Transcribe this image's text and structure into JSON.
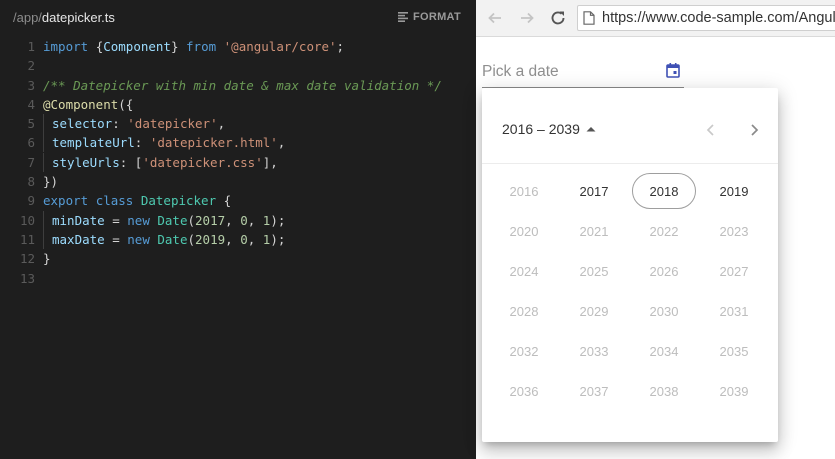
{
  "editor": {
    "path_dir": "/app/",
    "path_file": "datepicker.ts",
    "format_label": "FORMAT",
    "lines": [
      "1",
      "2",
      "3",
      "4",
      "5",
      "6",
      "7",
      "8",
      "9",
      "10",
      "11",
      "12",
      "13"
    ],
    "code": {
      "l1_import": "import ",
      "l1_brace_open": "{",
      "l1_component": "Component",
      "l1_brace_close": "} ",
      "l1_from": "from ",
      "l1_module": "'@angular/core'",
      "l1_semi": ";",
      "l3_comment": "/** Datepicker with min date & max date validation */",
      "l4_decorator": "@Component",
      "l4_paren": "({",
      "l5_key": "selector",
      "l5_colon": ": ",
      "l5_val": "'datepicker'",
      "l5_comma": ",",
      "l6_key": "templateUrl",
      "l6_colon": ": ",
      "l6_val": "'datepicker.html'",
      "l6_comma": ",",
      "l7_key": "styleUrls",
      "l7_colon": ": [",
      "l7_val": "'datepicker.css'",
      "l7_end": "],",
      "l8_close": "})",
      "l9_export": "export ",
      "l9_class": "class ",
      "l9_name": "Datepicker",
      "l9_brace": " {",
      "l10_prop": "minDate",
      "l10_eq": " = ",
      "l10_new": "new ",
      "l10_type": "Date",
      "l10_args_open": "(",
      "l10_n1": "2017",
      "l10_sep1": ", ",
      "l10_n2": "0",
      "l10_sep2": ", ",
      "l10_n3": "1",
      "l10_end": ");",
      "l11_prop": "maxDate",
      "l11_eq": " = ",
      "l11_new": "new ",
      "l11_type": "Date",
      "l11_args_open": "(",
      "l11_n1": "2019",
      "l11_sep1": ", ",
      "l11_n2": "0",
      "l11_sep2": ", ",
      "l11_n3": "1",
      "l11_end": ");",
      "l12_close": "}"
    }
  },
  "browser": {
    "url": "https://www.code-sample.com/Angular",
    "back_icon": "arrow-left-icon",
    "forward_icon": "arrow-right-icon",
    "reload_icon": "reload-icon",
    "page_icon": "page-icon"
  },
  "datepicker": {
    "placeholder": "Pick a date",
    "toggle_icon": "calendar-icon",
    "period_label": "2016 – 2039",
    "period_icon": "caret-up-icon",
    "prev_icon": "chevron-left-icon",
    "next_icon": "chevron-right-icon",
    "accent_color": "#3f51b5",
    "today_year": "2018",
    "years": [
      {
        "label": "2016",
        "enabled": false
      },
      {
        "label": "2017",
        "enabled": true
      },
      {
        "label": "2018",
        "enabled": true
      },
      {
        "label": "2019",
        "enabled": true
      },
      {
        "label": "2020",
        "enabled": false
      },
      {
        "label": "2021",
        "enabled": false
      },
      {
        "label": "2022",
        "enabled": false
      },
      {
        "label": "2023",
        "enabled": false
      },
      {
        "label": "2024",
        "enabled": false
      },
      {
        "label": "2025",
        "enabled": false
      },
      {
        "label": "2026",
        "enabled": false
      },
      {
        "label": "2027",
        "enabled": false
      },
      {
        "label": "2028",
        "enabled": false
      },
      {
        "label": "2029",
        "enabled": false
      },
      {
        "label": "2030",
        "enabled": false
      },
      {
        "label": "2031",
        "enabled": false
      },
      {
        "label": "2032",
        "enabled": false
      },
      {
        "label": "2033",
        "enabled": false
      },
      {
        "label": "2034",
        "enabled": false
      },
      {
        "label": "2035",
        "enabled": false
      },
      {
        "label": "2036",
        "enabled": false
      },
      {
        "label": "2037",
        "enabled": false
      },
      {
        "label": "2038",
        "enabled": false
      },
      {
        "label": "2039",
        "enabled": false
      }
    ]
  }
}
